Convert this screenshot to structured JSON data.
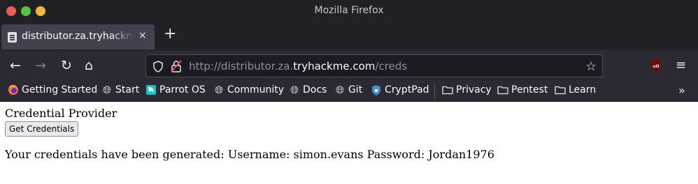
{
  "window": {
    "title": "Mozilla Firefox"
  },
  "tab": {
    "title": "distributor.za.tryhackme.com/creds",
    "close": "×",
    "new_tab": "+"
  },
  "urlbar": {
    "prefix": "http://distributor.za.",
    "domain": "tryhackme.com",
    "path": "/creds"
  },
  "nav": {
    "back": "←",
    "forward": "→",
    "reload": "↻",
    "home": "⌂",
    "star": "☆",
    "menu": "≡"
  },
  "bookmarks": [
    {
      "label": "Getting Started",
      "icon": "firefox-icon"
    },
    {
      "label": "Start",
      "icon": "globe-icon"
    },
    {
      "label": "Parrot OS",
      "icon": "parrot-icon"
    },
    {
      "label": "Community",
      "icon": "globe-icon"
    },
    {
      "label": "Docs",
      "icon": "globe-icon"
    },
    {
      "label": "Git",
      "icon": "globe-icon"
    },
    {
      "label": "CryptPad",
      "icon": "cryptpad-icon"
    },
    {
      "label": "Privacy",
      "icon": "folder-icon"
    },
    {
      "label": "Pentest",
      "icon": "folder-icon"
    },
    {
      "label": "Learn",
      "icon": "folder-icon"
    }
  ],
  "bookmarks_overflow": "»",
  "page": {
    "title": "Credential Provider",
    "button": "Get Credentials",
    "result": "Your credentials have been generated: Username: simon.evans Password: Jordan1976"
  },
  "colors": {
    "titlebar": "#202124",
    "toolbar": "#2b2a33",
    "urlbar": "#1c1b22",
    "close": "#ee5b56",
    "minimize": "#56c33f",
    "maximize": "#f1b83a"
  }
}
